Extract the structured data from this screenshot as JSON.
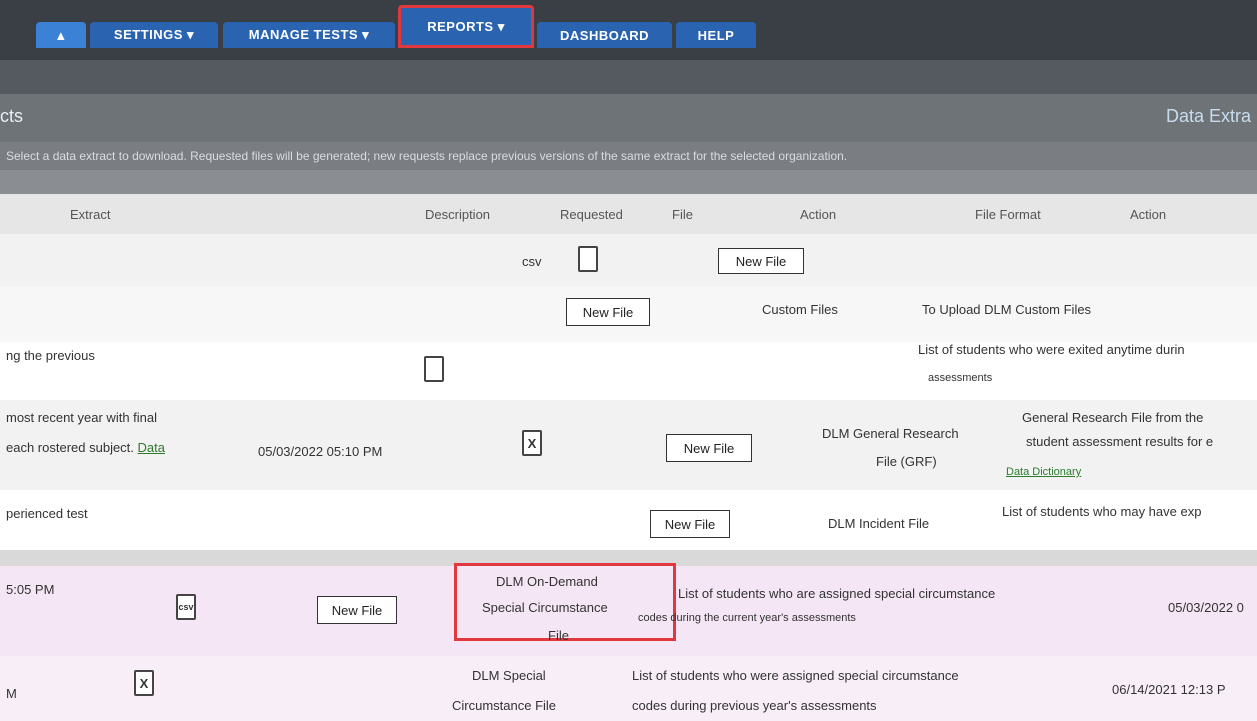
{
  "nav": {
    "tabs": [
      "SETTINGS ▾",
      "MANAGE TESTS ▾",
      "REPORTS ▾",
      "DASHBOARD",
      "HELP"
    ]
  },
  "page": {
    "title_left": "cts",
    "title_right": "Data Extra",
    "description": "Select a data extract to download. Requested files will be generated; new requests replace previous versions of the same extract for the selected organization."
  },
  "table": {
    "headers": [
      "Extract",
      "Description",
      "Requested",
      "File",
      "Action",
      "File Format",
      "Action"
    ]
  },
  "rows": {
    "row1": {
      "format": "csv",
      "button": "New File"
    },
    "row2": {
      "button": "New File",
      "name": "Custom Files",
      "desc": "To Upload DLM Custom Files"
    },
    "row3": {
      "desc_left": "ng the previous",
      "desc_right": "List of students who were exited anytime durin",
      "desc_right_2": "assessments"
    },
    "row4": {
      "desc_left_1": "most recent year with final",
      "desc_left_2": "each rostered subject.",
      "desc_left_link": "Data",
      "requested": "05/03/2022 05:10 PM",
      "button": "New File",
      "name_1": "DLM General Research",
      "name_2": "File (GRF)",
      "desc_right_1": "General Research File from the",
      "desc_right_2": "student assessment results for e",
      "desc_right_link": "Data Dictionary"
    },
    "row5": {
      "desc_left": "perienced test",
      "button": "New File",
      "name": "DLM Incident File",
      "desc_right": "List of students who may have exp"
    },
    "row6": {
      "requested_left": "5:05 PM",
      "format": "csv",
      "button": "New File",
      "name_1": "DLM On-Demand",
      "name_2": "Special Circumstance",
      "name_3": "File",
      "desc_1": "List of students who are assigned special circumstance",
      "desc_2": "codes during the current year's assessments",
      "requested_right": "05/03/2022 0"
    },
    "row7": {
      "requested_left": "M",
      "name_1": "DLM Special",
      "name_2": "Circumstance File",
      "desc_1": "List of students who were assigned special circumstance",
      "desc_2": "codes during previous year's assessments",
      "requested_right": "06/14/2021 12:13 P"
    }
  },
  "colors": {
    "nav_bg": "#3a3f46",
    "tab_blue": "#2a64b0",
    "highlight_red": "#e0383e",
    "row_pink": "#e8c6e8",
    "link_green": "#2c7a2c"
  }
}
